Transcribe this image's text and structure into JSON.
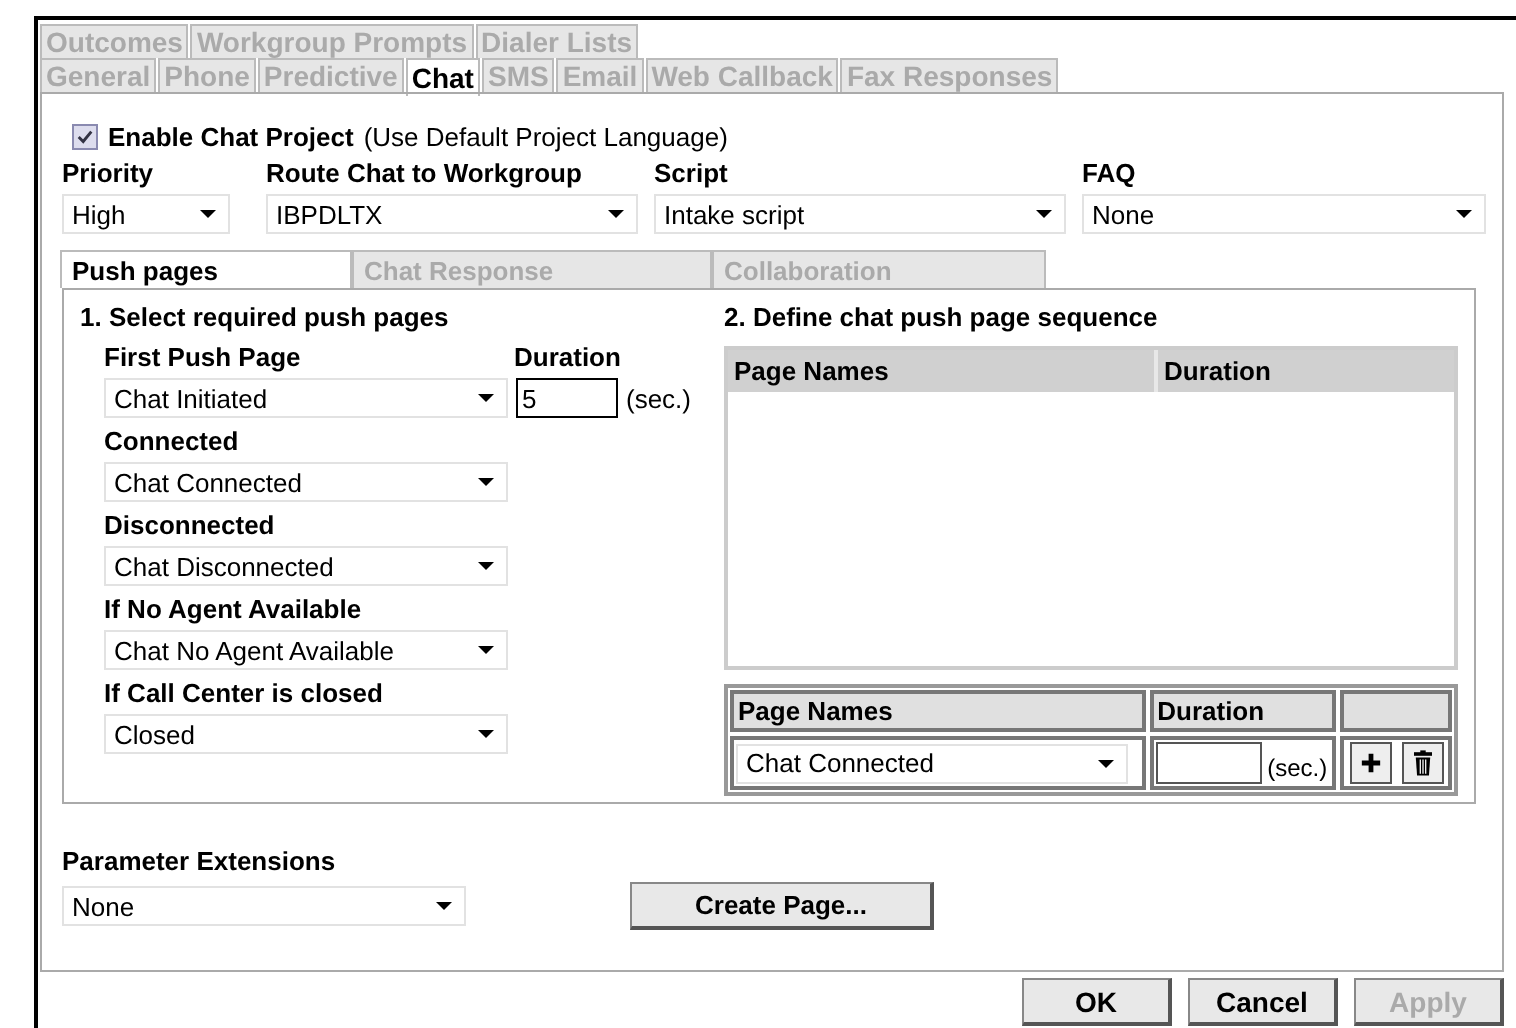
{
  "tab_rows": [
    [
      {
        "label": "Outcomes",
        "selected": false
      },
      {
        "label": "Workgroup Prompts",
        "selected": false
      },
      {
        "label": "Dialer Lists",
        "selected": false
      }
    ],
    [
      {
        "label": "General",
        "selected": false
      },
      {
        "label": "Phone",
        "selected": false
      },
      {
        "label": "Predictive",
        "selected": false
      },
      {
        "label": "Chat",
        "selected": true
      },
      {
        "label": "SMS",
        "selected": false
      },
      {
        "label": "Email",
        "selected": false
      },
      {
        "label": "Web Callback",
        "selected": false
      },
      {
        "label": "Fax Responses",
        "selected": false
      }
    ]
  ],
  "enable_chat": {
    "checked": true,
    "label": "Enable Chat Project",
    "note": "(Use Default Project Language)"
  },
  "fields": [
    {
      "label": "Priority",
      "value": "High"
    },
    {
      "label": "Route Chat to Workgroup",
      "value": "IBPDLTX"
    },
    {
      "label": "Script",
      "value": "Intake script"
    },
    {
      "label": "FAQ",
      "value": "None"
    }
  ],
  "subtabs": [
    {
      "label": "Push pages",
      "selected": true
    },
    {
      "label": "Chat Response",
      "selected": false
    },
    {
      "label": "Collaboration",
      "selected": false
    }
  ],
  "section1": {
    "title": "1. Select required push pages",
    "items": [
      {
        "label": "First Push Page",
        "value": "Chat Initiated"
      },
      {
        "label": "Connected",
        "value": "Chat Connected"
      },
      {
        "label": "Disconnected",
        "value": "Chat Disconnected"
      },
      {
        "label": "If No Agent Available",
        "value": "Chat No Agent Available"
      },
      {
        "label": "If Call Center is closed",
        "value": "Closed"
      }
    ],
    "duration": {
      "label": "Duration",
      "value": "5",
      "unit": "(sec.)"
    }
  },
  "section2": {
    "title": "2. Define chat push page sequence",
    "sequence_columns": [
      "Page Names",
      "Duration"
    ],
    "add_columns": [
      "Page Names",
      "Duration"
    ],
    "add_value": "Chat Connected",
    "add_unit": "(sec.)"
  },
  "parameter_extensions": {
    "label": "Parameter Extensions",
    "value": "None"
  },
  "create_button": "Create Page...",
  "buttons": [
    {
      "label": "OK",
      "disabled": false
    },
    {
      "label": "Cancel",
      "disabled": false
    },
    {
      "label": "Apply",
      "disabled": true
    }
  ]
}
